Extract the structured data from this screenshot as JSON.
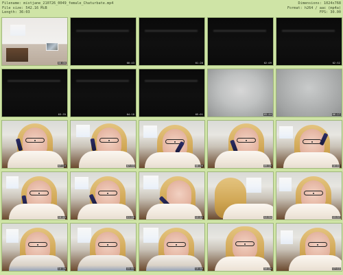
{
  "header": {
    "filename_line": "Filename: mistjane_210726_0049_female_Chaturbate.mp4",
    "filesize_line": "File size: 542.16 MiB",
    "length_line": "Length: 36:03",
    "dimensions_line": "Dimensions: 1024x768",
    "format_line": "Format: h264 / aac (mp4a)",
    "fps_line": "FPS: 30.00"
  },
  "thumbs": [
    {
      "ts": "00:00"
    },
    {
      "ts": "00:43"
    },
    {
      "ts": "01:26"
    },
    {
      "ts": "02:09"
    },
    {
      "ts": "02:52"
    },
    {
      "ts": "03:35"
    },
    {
      "ts": "04:18"
    },
    {
      "ts": "05:01"
    },
    {
      "ts": "05:44"
    },
    {
      "ts": "06:27"
    },
    {
      "ts": "07:10"
    },
    {
      "ts": "07:53"
    },
    {
      "ts": "08:36"
    },
    {
      "ts": "09:19"
    },
    {
      "ts": "10:02"
    },
    {
      "ts": "10:45"
    },
    {
      "ts": "11:28"
    },
    {
      "ts": "12:11"
    },
    {
      "ts": "12:54"
    },
    {
      "ts": "13:37"
    },
    {
      "ts": "14:20"
    },
    {
      "ts": "15:03"
    },
    {
      "ts": "15:46"
    },
    {
      "ts": "16:29"
    },
    {
      "ts": "17:12"
    }
  ]
}
